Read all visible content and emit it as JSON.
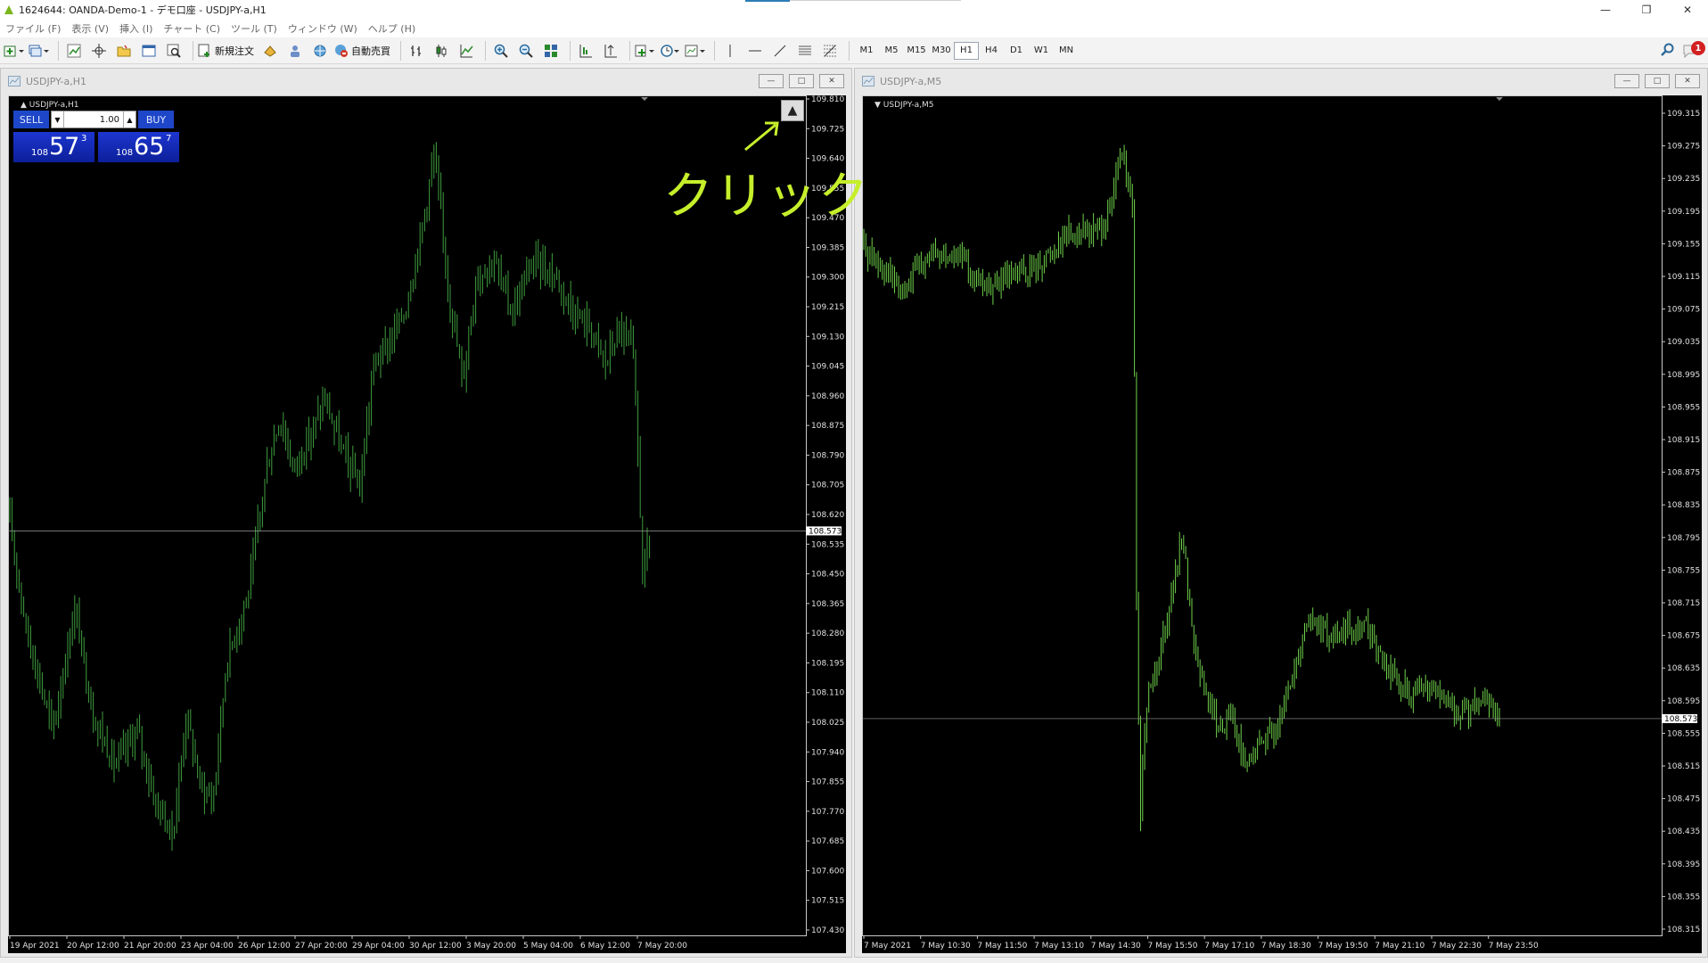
{
  "window": {
    "title": "1624644: OANDA-Demo-1 - デモ口座 - USDJPY-a,H1"
  },
  "menu": [
    "ファイル (F)",
    "表示 (V)",
    "挿入 (I)",
    "チャート (C)",
    "ツール (T)",
    "ウィンドウ (W)",
    "ヘルプ (H)"
  ],
  "toolbar": {
    "new_order_label": "新規注文",
    "auto_trading_label": "自動売買",
    "periods": [
      "M1",
      "M5",
      "M15",
      "M30",
      "H1",
      "H4",
      "D1",
      "W1",
      "MN"
    ],
    "active_period": "H1",
    "notification_count": "1"
  },
  "annotation": {
    "text": "クリック"
  },
  "charts": [
    {
      "window_title": "USDJPY-a,H1",
      "inner_label": "USDJPY-a,H1",
      "current_price": "108.573",
      "price_ticks": [
        "109.810",
        "109.725",
        "109.640",
        "109.555",
        "109.470",
        "109.385",
        "109.300",
        "109.215",
        "109.130",
        "109.045",
        "108.960",
        "108.875",
        "108.790",
        "108.705",
        "108.620",
        "108.535",
        "108.450",
        "108.365",
        "108.280",
        "108.195",
        "108.110",
        "108.025",
        "107.940",
        "107.855",
        "107.770",
        "107.685",
        "107.600",
        "107.515",
        "107.430"
      ],
      "time_ticks": [
        "19 Apr 2021",
        "20 Apr 12:00",
        "21 Apr 20:00",
        "23 Apr 04:00",
        "26 Apr 12:00",
        "27 Apr 20:00",
        "29 Apr 04:00",
        "30 Apr 12:00",
        "3 May 20:00",
        "5 May 04:00",
        "6 May 12:00",
        "7 May 20:00"
      ]
    },
    {
      "window_title": "USDJPY-a,M5",
      "inner_label": "USDJPY-a,M5",
      "current_price": "108.573",
      "price_ticks": [
        "109.315",
        "109.275",
        "109.235",
        "109.195",
        "109.155",
        "109.115",
        "109.075",
        "109.035",
        "108.995",
        "108.955",
        "108.915",
        "108.875",
        "108.835",
        "108.795",
        "108.755",
        "108.715",
        "108.675",
        "108.635",
        "108.595",
        "108.555",
        "108.515",
        "108.475",
        "108.435",
        "108.395",
        "108.355",
        "108.315"
      ],
      "time_ticks": [
        "7 May 2021",
        "7 May 10:30",
        "7 May 11:50",
        "7 May 13:10",
        "7 May 14:30",
        "7 May 15:50",
        "7 May 17:10",
        "7 May 18:30",
        "7 May 19:50",
        "7 May 21:10",
        "7 May 22:30",
        "7 May 23:50"
      ]
    }
  ],
  "trade_panel": {
    "sell_label": "SELL",
    "buy_label": "BUY",
    "lot": "1.00",
    "sell_prefix": "108",
    "sell_big": "57",
    "sell_sup": "3",
    "buy_prefix": "108",
    "buy_big": "65",
    "buy_sup": "7"
  }
}
